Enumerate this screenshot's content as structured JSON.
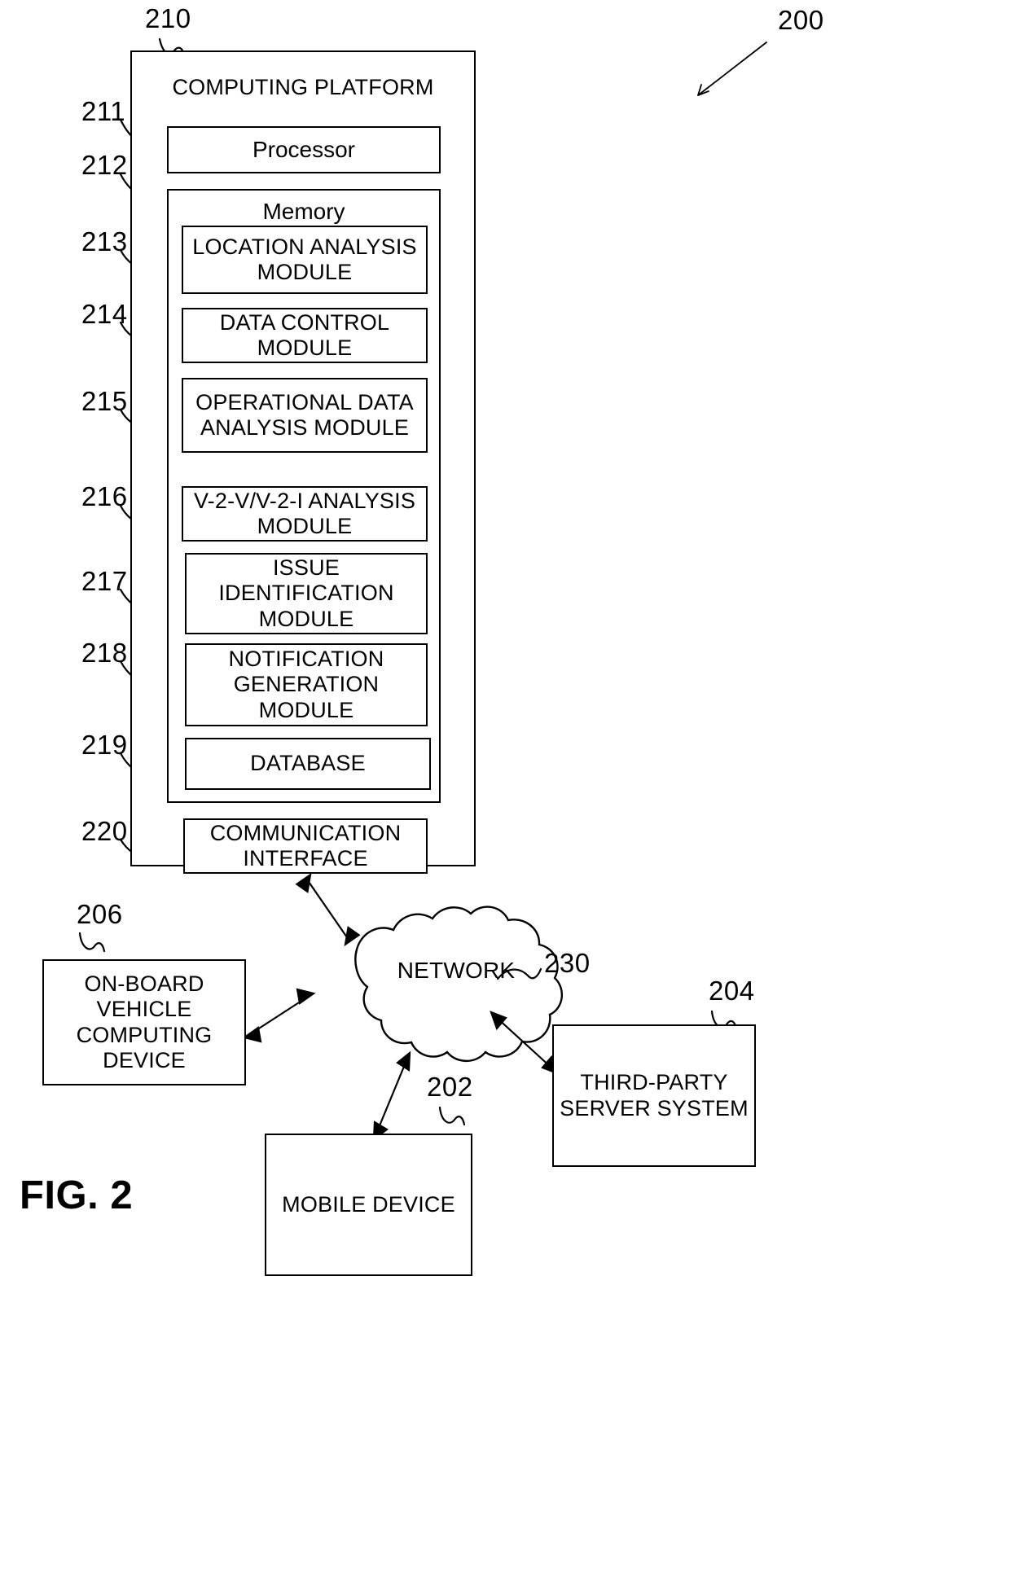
{
  "figure": {
    "label": "FIG. 2",
    "system_ref": "200"
  },
  "platform": {
    "ref": "210",
    "title": "COMPUTING PLATFORM",
    "processor": {
      "ref": "211",
      "label": "Processor"
    },
    "memory": {
      "ref": "212",
      "label": "Memory",
      "modules": [
        {
          "ref": "213",
          "label": "LOCATION ANALYSIS MODULE"
        },
        {
          "ref": "214",
          "label": "DATA CONTROL MODULE"
        },
        {
          "ref": "215",
          "label": "OPERATIONAL DATA ANALYSIS MODULE"
        },
        {
          "ref": "216",
          "label": "V-2-V/V-2-I ANALYSIS MODULE"
        },
        {
          "ref": "217",
          "label": "ISSUE IDENTIFICATION MODULE"
        },
        {
          "ref": "218",
          "label": "NOTIFICATION GENERATION MODULE"
        },
        {
          "ref": "219",
          "label": "DATABASE"
        }
      ]
    },
    "communication_interface": {
      "ref": "220",
      "label": "COMMUNICATION INTERFACE"
    }
  },
  "network": {
    "ref": "230",
    "label": "NETWORK"
  },
  "nodes": [
    {
      "ref": "206",
      "label": "ON-BOARD VEHICLE COMPUTING DEVICE"
    },
    {
      "ref": "202",
      "label": "MOBILE DEVICE"
    },
    {
      "ref": "204",
      "label": "THIRD-PARTY SERVER SYSTEM"
    }
  ],
  "colors": {
    "ink": "#000000",
    "paper": "#ffffff"
  }
}
